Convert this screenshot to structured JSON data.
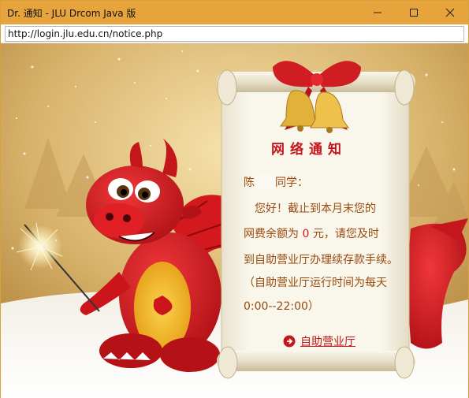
{
  "window": {
    "title": "Dr. 通知 - JLU Drcom Java 版",
    "controls": [
      "minimize-icon",
      "maximize-icon",
      "close-icon"
    ]
  },
  "address": {
    "url": "http://login.jlu.edu.cn/notice.php"
  },
  "notice": {
    "title": "网络通知",
    "greeting_prefix": "陈",
    "greeting_suffix": "同学：",
    "line1": "您好！截止到本月末您的",
    "line2_prefix": "网费余额为",
    "balance": "0",
    "line2_suffix": "元，请您及时",
    "line3": "到自助营业厅办理续存款手续。",
    "line4": "（自助营业厅运行时间为每天",
    "line5": "0:00--22:00）",
    "link_label": "自助营业厅"
  },
  "colors": {
    "titlebar": "#e8a43c",
    "notice_title": "#c4171b",
    "notice_text": "#9a4b0d",
    "balance": "#d81414"
  },
  "icons": {
    "link_icon": "arrow-right-circle-icon",
    "bow": "bow-icon",
    "bells": "bell-icon",
    "dragon": "dragon-mascot",
    "sparkler": "sparkler-icon"
  }
}
